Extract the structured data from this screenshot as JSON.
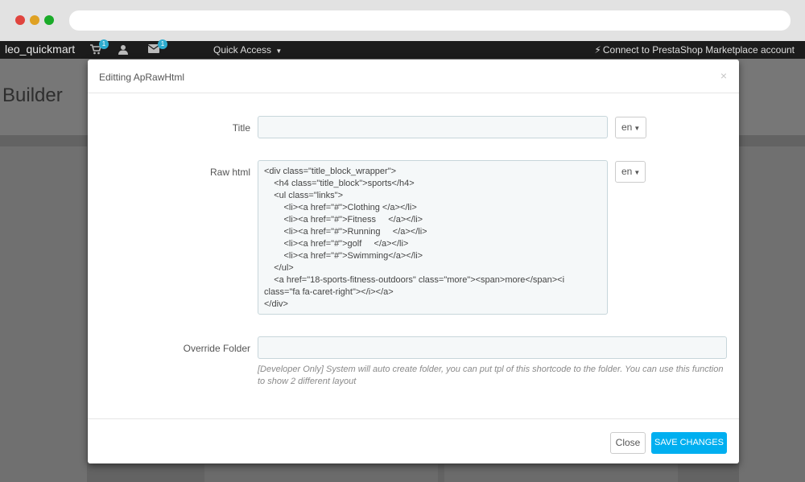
{
  "admin": {
    "shop_name": "leo_quickmart",
    "cart_badge": "1",
    "mail_badge": "1",
    "quick_access": "Quick Access",
    "connect_link": "Connect to PrestaShop Marketplace account"
  },
  "page": {
    "title": "Builder"
  },
  "modal": {
    "title": "Editting ApRawHtml",
    "close_icon": "×",
    "fields": {
      "title_label": "Title",
      "title_value": "",
      "title_lang": "en",
      "raw_label": "Raw html",
      "raw_value": "<div class=\"title_block_wrapper\">\n    <h4 class=\"title_block\">sports</h4>\n    <ul class=\"links\">\n        <li><a href=\"#\">Clothing </a></li>\n        <li><a href=\"#\">Fitness     </a></li>\n        <li><a href=\"#\">Running     </a></li>\n        <li><a href=\"#\">golf     </a></li>\n        <li><a href=\"#\">Swimming</a></li>\n    </ul>\n    <a href=\"18-sports-fitness-outdoors\" class=\"more\"><span>more</span><i class=\"fa fa-caret-right\"></i></a>\n</div>",
      "raw_lang": "en",
      "folder_label": "Override Folder",
      "folder_value": "",
      "folder_help": "[Developer Only] System will auto create folder, you can put tpl of this shortcode to the folder. You can use this function to show 2 different layout"
    },
    "buttons": {
      "close": "Close",
      "save": "SAVE CHANGES"
    }
  },
  "colors": {
    "accent": "#00aff0",
    "badge": "#2eacce",
    "header_bg": "#1c1c1c"
  }
}
